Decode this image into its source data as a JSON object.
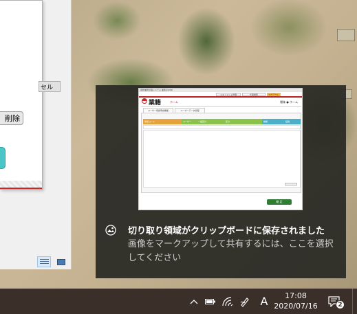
{
  "left_window": {
    "cancel_label": "セル",
    "delete_label": "削除"
  },
  "toast": {
    "title": "切り取り領域がクリップボードに保存されました",
    "body": "画像をマークアップして共有するには、ここを選択してください",
    "preview": {
      "window_title": "国際業務管理システム 業務のWEB",
      "top_buttons": [
        "ドキュメント管理",
        "伝票閲覧",
        "ログアウト"
      ],
      "brand": "業籍",
      "home_link": "ホーム",
      "header_right": "曖昧 ● ホーム",
      "tabs": [
        "ユーザー登録申請機能",
        "ユーザーデータ管理"
      ],
      "columns": [
        "承認コード",
        "ユーザー",
        "一般区分",
        "区分",
        "種類",
        "役職"
      ],
      "column_colors": [
        "#e6a23c",
        "#8bc34a",
        "#8bc34a",
        "#8bc34a",
        "#4cafc8",
        "#4cafc8"
      ],
      "ok_label": "確 定"
    }
  },
  "taskbar": {
    "ime_label": "A",
    "time": "17:08",
    "date": "2020/07/16",
    "notification_count": "2"
  },
  "icons": {
    "chevron": "chevron-up-icon",
    "battery": "battery-icon",
    "wifi": "wifi-icon",
    "pen": "pen-icon",
    "notification": "action-center-icon",
    "snip": "snip-sketch-icon"
  }
}
